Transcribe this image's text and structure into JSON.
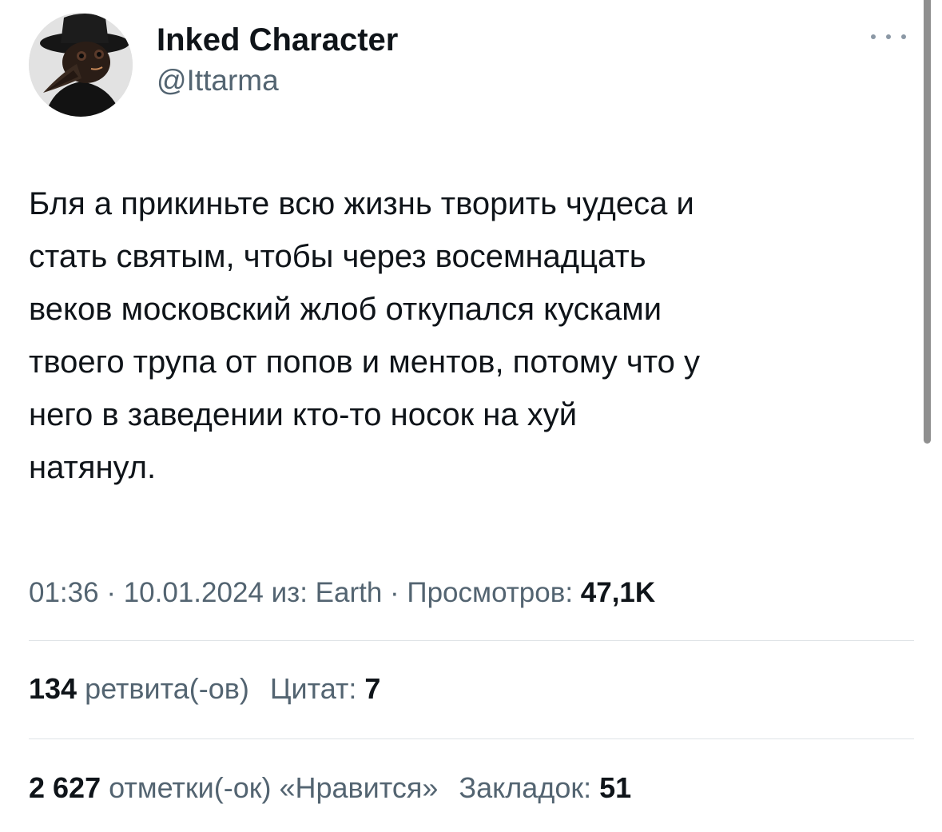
{
  "author": {
    "display_name": "Inked Character",
    "handle": "@Ittarma",
    "avatar_icon": "plague-doctor-avatar"
  },
  "more_icon": "more-dots-icon",
  "tweet": {
    "lines": [
      "Бля а прикиньте всю жизнь творить чудеса и",
      "стать святым, чтобы через восемнадцать",
      "веков московский жлоб откупался кусками",
      "твоего трупа от попов и ментов, потому что у",
      "него в заведении кто-то носок на хуй",
      "натянул."
    ]
  },
  "meta": {
    "time": "01:36",
    "separator": " · ",
    "date": "10.01.2024",
    "source_prefix": " из: ",
    "source": "Earth",
    "views_label": "Просмотров: ",
    "views_count": "47,1K"
  },
  "stats": {
    "retweets_count": "134",
    "retweets_label": " ретвита(-ов)",
    "quotes_label": "Цитат: ",
    "quotes_count": "7",
    "likes_count": "2 627",
    "likes_label": " отметки(-ок) «Нравится»",
    "bookmarks_label": "Закладок: ",
    "bookmarks_count": "51"
  },
  "colors": {
    "text_primary": "#0f1419",
    "text_secondary": "#536471",
    "divider": "#dfe3e6"
  }
}
